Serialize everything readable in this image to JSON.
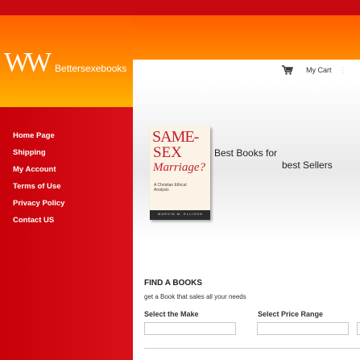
{
  "brand": {
    "logo_mark": "W W",
    "name": "Bettersexebooks"
  },
  "nav": {
    "items": [
      {
        "label": "Home Page"
      },
      {
        "label": "Shipping"
      },
      {
        "label": "My Account"
      },
      {
        "label": "Terms of Use"
      },
      {
        "label": "Privacy Policy"
      },
      {
        "label": "Contact US"
      }
    ]
  },
  "header": {
    "cart_label": "My Cart",
    "cart_icon": "shopping-cart-icon"
  },
  "banner": {
    "book": {
      "title_line1": "SAME-",
      "title_line2": "SEX",
      "title_line3": "Marriage?",
      "subtitle": "A Christian Ethical Analysis",
      "author": "MARVIN M. ELLISON"
    },
    "tagline_1": "Best Books for",
    "tagline_2": "best Sellers"
  },
  "finder": {
    "title": "FIND A BOOKS",
    "subtitle": "get a Book that sales all your needs",
    "make_label": "Select the Make",
    "make_value": "",
    "price_label": "Select Price Range",
    "price_value": ""
  },
  "colors": {
    "top_bar": "#c8090f",
    "orange": "#ff7a00",
    "sidebar": "#c8000a"
  }
}
